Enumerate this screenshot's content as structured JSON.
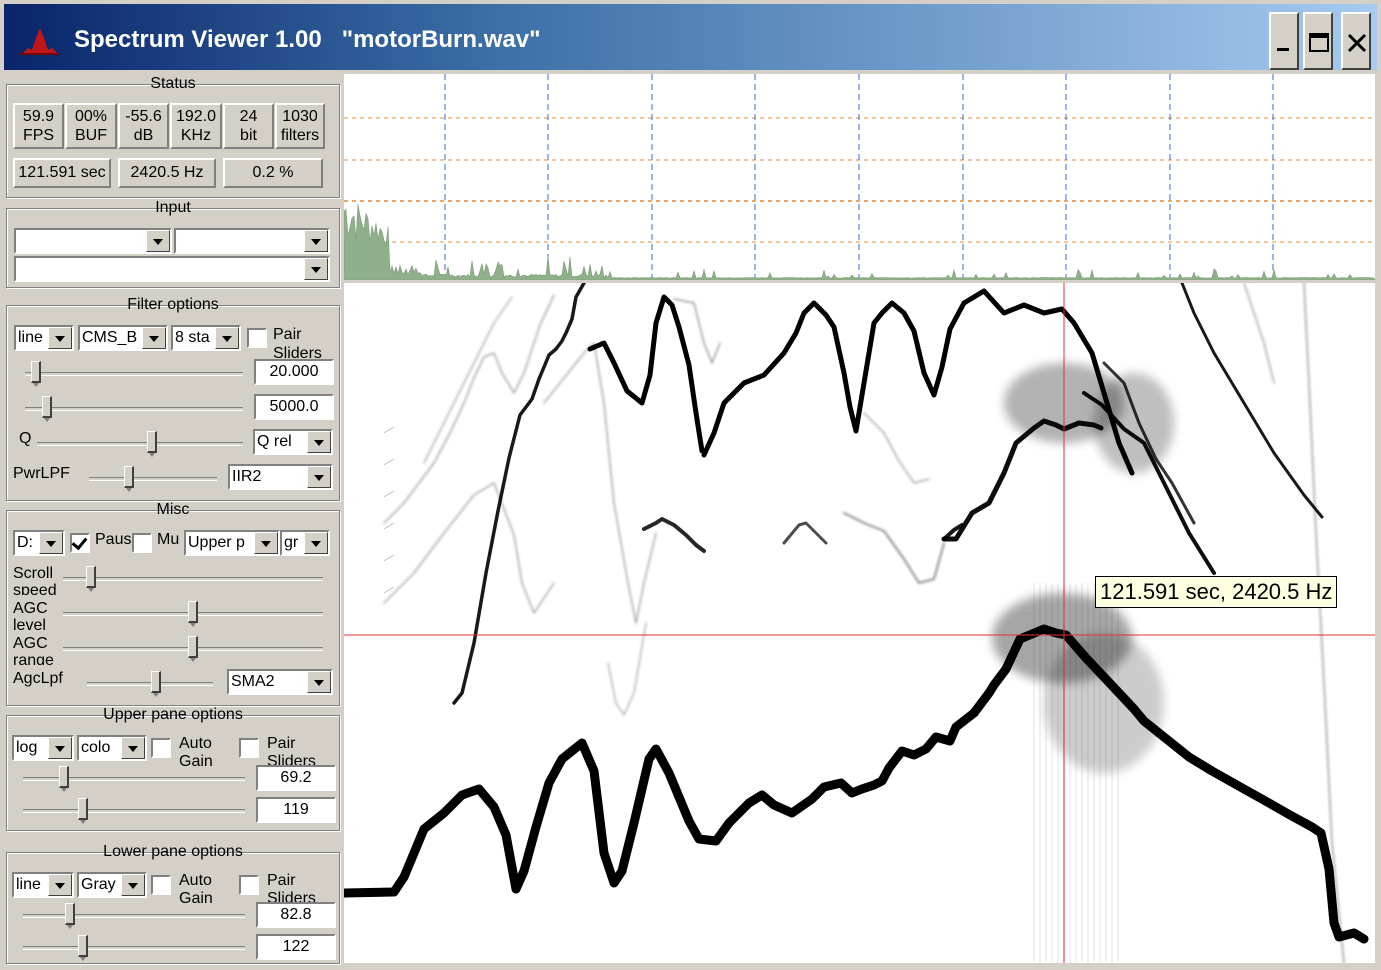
{
  "window": {
    "title": "Spectrum Viewer 1.00   \"motorBurn.wav\"",
    "icons": {
      "app": "spectrum-app-icon",
      "minimize": "minimize-icon",
      "maximize": "maximize-icon",
      "close": "close-icon"
    }
  },
  "status": {
    "title": "Status",
    "stats": [
      {
        "top": "59.9",
        "bottom": "FPS"
      },
      {
        "top": "00%",
        "bottom": "BUF"
      },
      {
        "top": "-55.6",
        "bottom": "dB"
      },
      {
        "top": "192.0",
        "bottom": "KHz"
      },
      {
        "top": "24",
        "bottom": "bit"
      },
      {
        "top": "1030",
        "bottom": "filters"
      }
    ],
    "time": "121.591 sec",
    "freq": "2420.5 Hz",
    "percent": "0.2 %"
  },
  "input": {
    "title": "Input",
    "device": "",
    "channel": "",
    "source": ""
  },
  "filter": {
    "title": "Filter options",
    "scale": "line",
    "filter_type": "CMS_B",
    "stages": "8 sta",
    "pair_label": "Pair Sliders",
    "pair_checked": false,
    "min_value": "20.000",
    "max_value": "5000.0",
    "min_slider": 0.03,
    "max_slider": 0.08,
    "q_label": "Q",
    "q_slider": 0.56,
    "q_mode": "Q rel",
    "pwr_label": "PwrLPF",
    "pwr_slider": 0.3,
    "pwr_mode": "IIR2"
  },
  "misc": {
    "title": "Misc",
    "mode": "D:",
    "pause_label": "Paus",
    "pause_checked": true,
    "mute_label": "Mu",
    "mute_checked": false,
    "pane": "Upper p",
    "extra": "gr",
    "scroll_label": "Scroll speed",
    "scroll_slider": 0.09,
    "agc_level_label": "AGC level",
    "agc_level_slider": 0.5,
    "agc_range_label": "AGC range",
    "agc_range_slider": 0.5,
    "agclpf_label": "AgcLpf",
    "agclpf_slider": 0.55,
    "agclpf_mode": "SMA2"
  },
  "upper_pane": {
    "title": "Upper pane options",
    "scale": "log",
    "palette": "colo",
    "auto_gain_label": "Auto Gain",
    "auto_gain_checked": false,
    "pair_label": "Pair Sliders",
    "pair_checked": false,
    "value1": "69.2",
    "value2": "119",
    "slider1": 0.17,
    "slider2": 0.26
  },
  "lower_pane": {
    "title": "Lower pane options",
    "scale": "line",
    "palette": "Gray",
    "auto_gain_label": "Auto Gain",
    "auto_gain_checked": false,
    "pair_label": "Pair Sliders",
    "pair_checked": false,
    "value1": "82.8",
    "value2": "122",
    "slider1": 0.2,
    "slider2": 0.26
  },
  "cursor": {
    "readout": "121.591 sec, 2420.5 Hz"
  },
  "colors": {
    "spectrum_fill": "#8fb08a",
    "grid_h": "#e08a3a",
    "grid_v": "#3a6ad0",
    "cursor": "#e0303a",
    "tooltip_bg": "#ffffe1"
  }
}
